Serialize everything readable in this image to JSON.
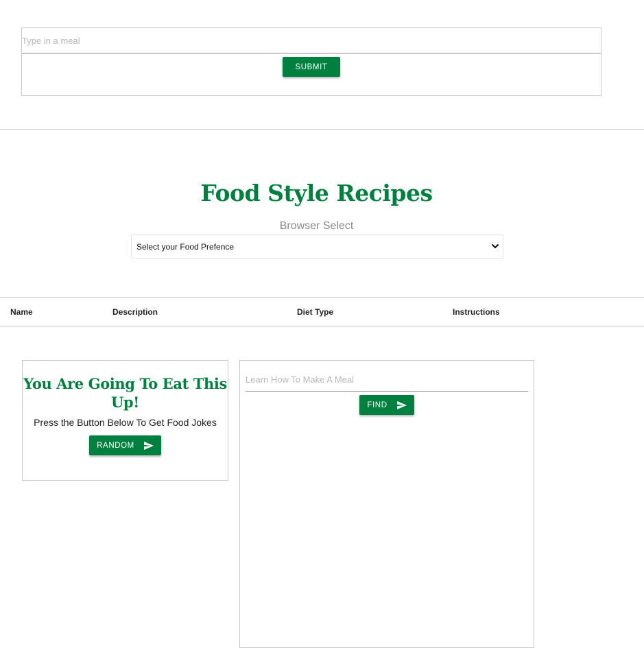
{
  "meal_form": {
    "placeholder": "Type in a meal",
    "submit_label": "SUBMIT"
  },
  "recipes": {
    "title": "Food Style Recipes",
    "subtitle": "Browser Select",
    "select_value": "Select your Food Prefence"
  },
  "table": {
    "headers": [
      "Name",
      "Description",
      "Diet Type",
      "Instructions"
    ]
  },
  "joke_card": {
    "title": "You Are Going To Eat This Up!",
    "subtitle": "Press the Button Below To Get Food Jokes",
    "button_label": "RANDOM"
  },
  "learn_card": {
    "placeholder": "Learn How To Make A Meal",
    "button_label": "FIND"
  },
  "colors": {
    "brand_green": "#00803e"
  },
  "icons": {
    "send": "send-icon",
    "dropdown": "chevron-down-icon"
  }
}
